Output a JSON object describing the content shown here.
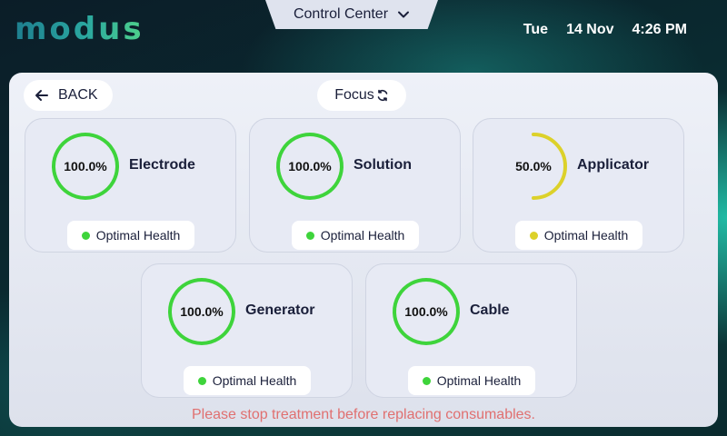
{
  "header": {
    "logo_text": "modus",
    "control_center_label": "Control Center",
    "day": "Tue",
    "date": "14 Nov",
    "time": "4:26 PM"
  },
  "toolbar": {
    "back_label": "BACK",
    "focus_label": "Focus"
  },
  "consumables": [
    {
      "name": "Electrode",
      "percent_label": "100.0%",
      "level": 1.0,
      "status": "Optimal Health",
      "color": "#3ed43b"
    },
    {
      "name": "Solution",
      "percent_label": "100.0%",
      "level": 1.0,
      "status": "Optimal Health",
      "color": "#3ed43b"
    },
    {
      "name": "Applicator",
      "percent_label": "50.0%",
      "level": 0.5,
      "status": "Optimal Health",
      "color": "#dcd12a",
      "status_dot_color": "#dcd12a"
    },
    {
      "name": "Generator",
      "percent_label": "100.0%",
      "level": 1.0,
      "status": "Optimal Health",
      "color": "#3ed43b"
    },
    {
      "name": "Cable",
      "percent_label": "100.0%",
      "level": 1.0,
      "status": "Optimal Health",
      "color": "#3ed43b"
    }
  ],
  "warning_text": "Please stop treatment before replacing consumables.",
  "icons": {
    "control_center": "chevron-down-icon",
    "back": "arrow-left-icon",
    "focus": "refresh-icon"
  },
  "colors": {
    "ok": "#3ed43b",
    "warn_ring": "#dcd12a",
    "warning_text": "#e07070"
  }
}
